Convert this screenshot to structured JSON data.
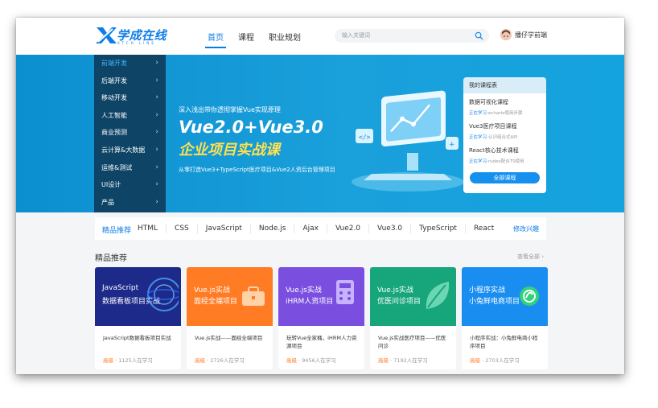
{
  "header": {
    "logo_text": "学成在线",
    "logo_sub": "XTCH LINE",
    "nav": [
      "首页",
      "课程",
      "职业规划"
    ],
    "search_placeholder": "输入关键词",
    "user_name": "播仔学前端"
  },
  "sidebar": {
    "items": [
      {
        "label": "前端开发"
      },
      {
        "label": "后端开发"
      },
      {
        "label": "移动开发"
      },
      {
        "label": "人工智能"
      },
      {
        "label": "商业预测"
      },
      {
        "label": "云计算&大数据"
      },
      {
        "label": "运维&测试"
      },
      {
        "label": "UI设计"
      },
      {
        "label": "产品"
      }
    ]
  },
  "banner": {
    "line1": "深入浅出带你透彻掌握Vue实现原理",
    "title": "Vue2.0+Vue3.0",
    "title2": "企业项目实战课",
    "line3": "从零打造Vue3+TypeScript医疗项目&Vue2人资后台管理项目"
  },
  "my_courses": {
    "title": "我的课程表",
    "items": [
      {
        "name": "数据可视化课程",
        "prefix": "正在学习",
        "status": "-echarts使用步骤"
      },
      {
        "name": "Vue3医疗项目课程",
        "prefix": "正在学习",
        "status": "-认识组合式API"
      },
      {
        "name": "React核心技术课程",
        "prefix": "正在学习",
        "status": "-rudex配合TS使用"
      }
    ],
    "button": "全部课程"
  },
  "tagbar": {
    "title": "精品推荐",
    "tags": [
      "HTML",
      "CSS",
      "JavaScript",
      "Node.js",
      "Ajax",
      "Vue2.0",
      "Vue3.0",
      "TypeScript",
      "React"
    ],
    "edit": "修改兴趣"
  },
  "section": {
    "title": "精品推荐",
    "more": "查看全部 ›"
  },
  "cards": [
    {
      "thumb1": "JavaScript",
      "thumb2": "数据看板项目实战",
      "title": "JavaScript数据看板项目实战",
      "level": "高级",
      "learners": "1125人在学习",
      "color": "#1d2a8a",
      "icon": "globe-icon"
    },
    {
      "thumb1": "Vue.js实战",
      "thumb2": "面经全端项目",
      "title": "Vue.js实战——面经全端项目",
      "level": "高级",
      "learners": "2726人在学习",
      "color": "#ff7b24",
      "icon": "briefcase-icon"
    },
    {
      "thumb1": "Vue.js实战",
      "thumb2": "iHRM人资项目",
      "title": "玩转Vue全家桶，iHRM人力资源项目",
      "level": "高级",
      "learners": "9456人在学习",
      "color": "#7a4fe0",
      "icon": "calculator-icon"
    },
    {
      "thumb1": "Vue.js实战",
      "thumb2": "优医问诊项目",
      "title": "Vue.js实战医疗项目——优医问诊",
      "level": "高级",
      "learners": "7192人在学习",
      "color": "#17a57b",
      "icon": "leaf-icon"
    },
    {
      "thumb1": "小程序实战",
      "thumb2": "小兔鲜电商项目",
      "title": "小程序实战：小兔鲜电商小程序项目",
      "level": "高级",
      "learners": "2703人在学习",
      "color": "#1a8ef0",
      "icon": "wechat-icon"
    }
  ],
  "colors": {
    "brand": "#0f7de8",
    "banner": "#1aa0db",
    "level": "#ff7a22"
  }
}
